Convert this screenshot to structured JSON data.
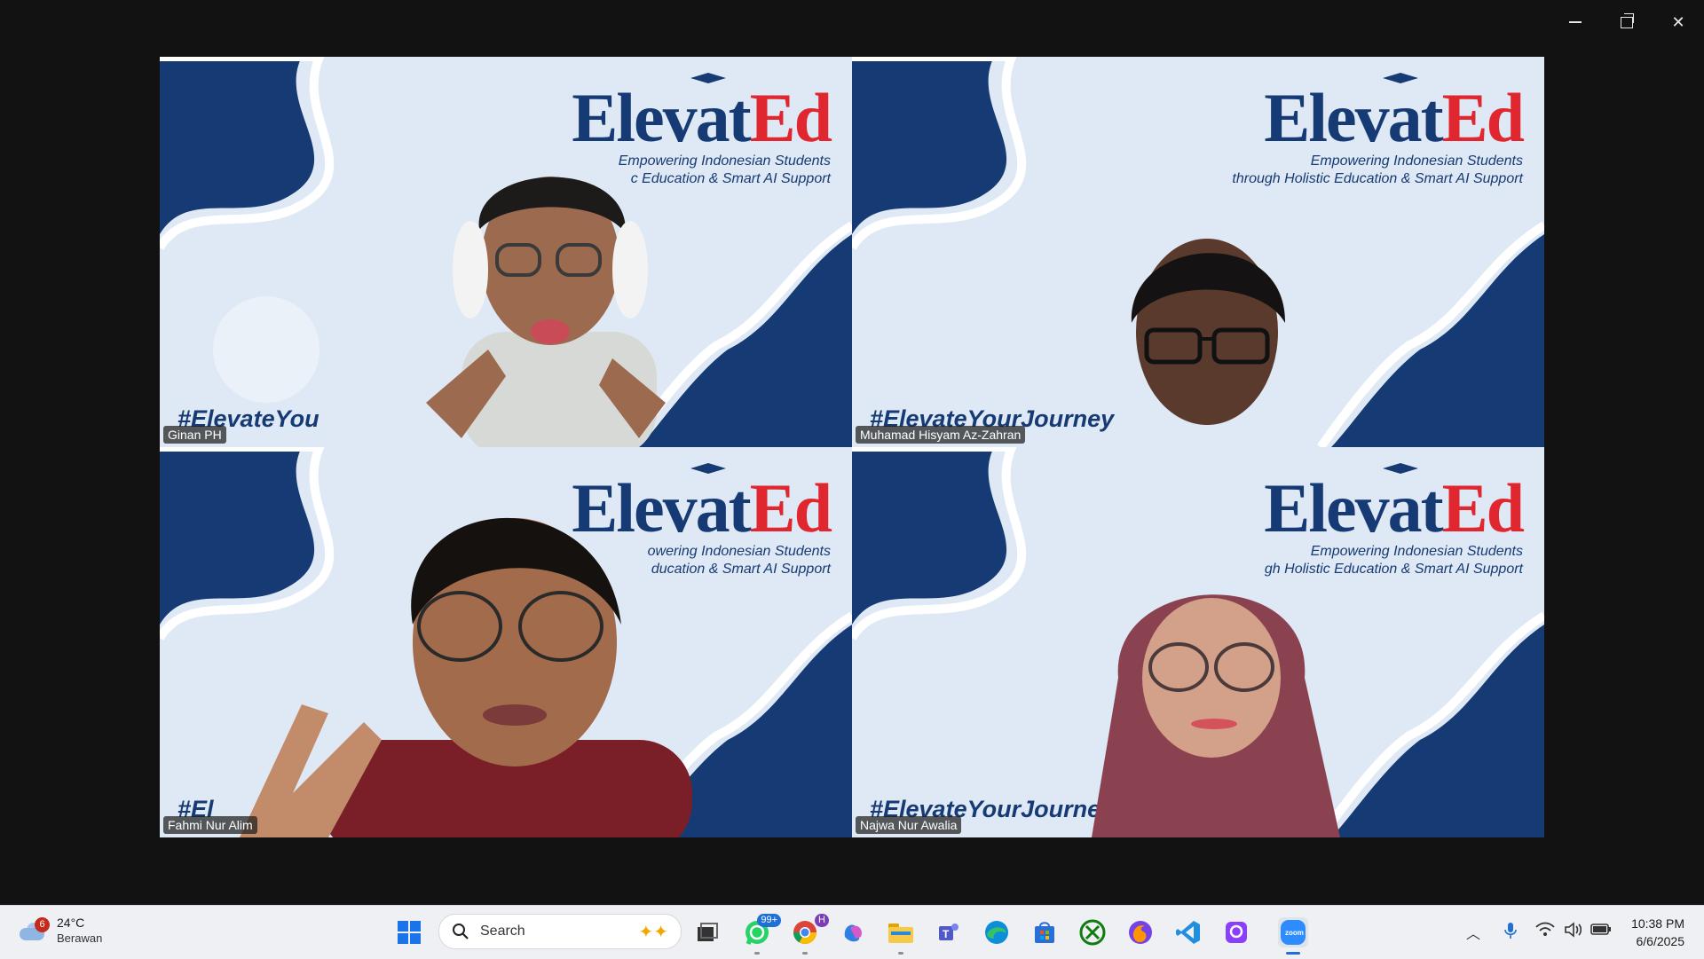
{
  "window": {
    "controls": [
      "minimize",
      "restore",
      "close"
    ]
  },
  "tiles": [
    {
      "name": "Ginan PH",
      "brand_logo_left": "Elevat",
      "brand_logo_right": "Ed",
      "tagline1": "Empowering Indonesian Students",
      "tagline2": "c Education & Smart AI Support",
      "hashtag": "#ElevateYou",
      "active": false
    },
    {
      "name": "Muhamad Hisyam Az-Zahran",
      "brand_logo_left": "Elevat",
      "brand_logo_right": "Ed",
      "tagline1": "Empowering Indonesian Students",
      "tagline2": "through Holistic Education & Smart AI Support",
      "hashtag": "#ElevateYourJourney",
      "active": false
    },
    {
      "name": "Fahmi Nur Alim",
      "brand_logo_left": "Elevat",
      "brand_logo_right": "Ed",
      "tagline1": "owering Indonesian Students",
      "tagline2": "ducation & Smart AI Support",
      "hashtag": "#El",
      "active": false
    },
    {
      "name": "Najwa Nur Awalia",
      "brand_logo_left": "Elevat",
      "brand_logo_right": "Ed",
      "tagline1": "Empowering Indonesian Students",
      "tagline2": "gh Holistic Education & Smart AI Support",
      "hashtag": "#ElevateYourJourney",
      "active": true
    }
  ],
  "taskbar": {
    "weather": {
      "temp": "24°C",
      "condition": "Berawan",
      "badge": "6"
    },
    "search_label": "Search",
    "whatsapp_badge": "99+",
    "chrome_badge": "H",
    "apps": [
      "start-icon",
      "search-icon",
      "task-view-icon",
      "whatsapp-icon",
      "chrome-icon",
      "copilot-icon",
      "file-explorer-icon",
      "teams-icon",
      "edge-icon",
      "store-icon",
      "xbox-icon",
      "firefox-icon",
      "vscode-icon",
      "proton-icon",
      "zoom-icon"
    ],
    "clock": {
      "time": "10:38 PM",
      "date": "6/6/2025"
    }
  },
  "colors": {
    "brand_blue": "#163a73",
    "brand_red": "#e0262f",
    "active_border": "#27d08e",
    "window_bg": "#121212"
  }
}
